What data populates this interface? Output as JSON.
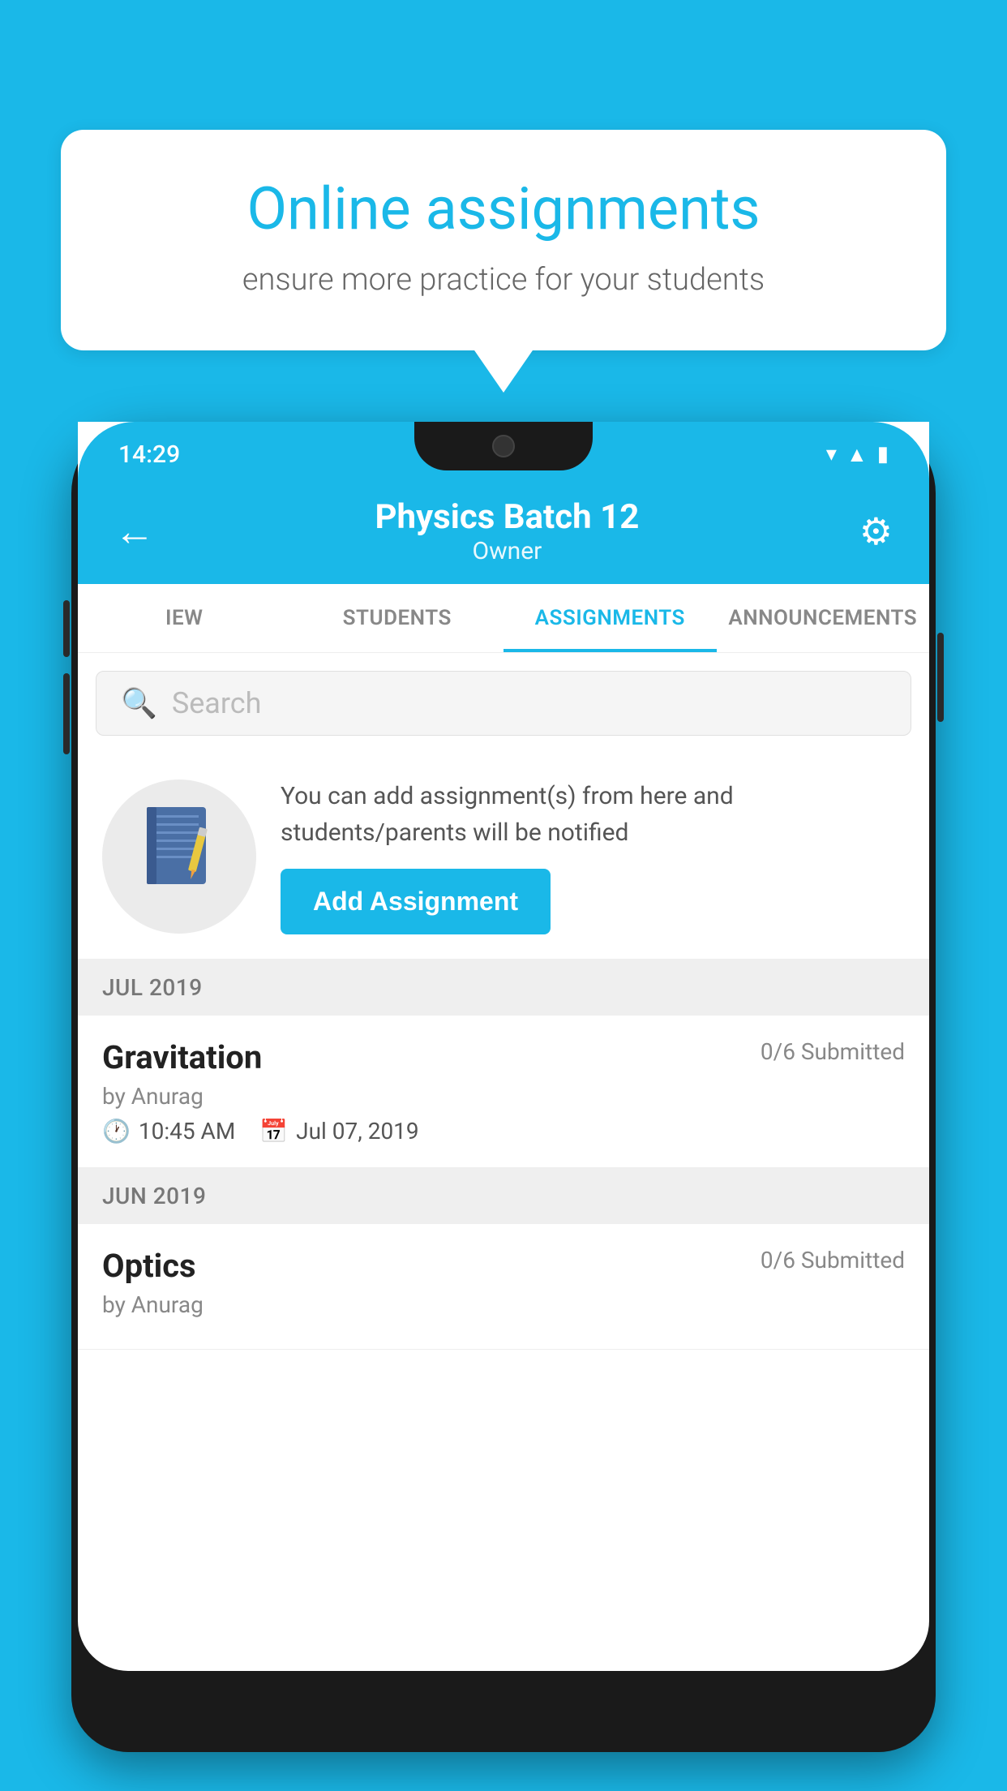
{
  "background_color": "#1ab8e8",
  "speech_bubble": {
    "title": "Online assignments",
    "subtitle": "ensure more practice for your students"
  },
  "phone": {
    "status_bar": {
      "time": "14:29",
      "icons": [
        "wifi",
        "signal",
        "battery"
      ]
    },
    "header": {
      "title": "Physics Batch 12",
      "subtitle": "Owner",
      "back_label": "←",
      "gear_label": "⚙"
    },
    "tabs": [
      {
        "label": "IEW",
        "active": false
      },
      {
        "label": "STUDENTS",
        "active": false
      },
      {
        "label": "ASSIGNMENTS",
        "active": true
      },
      {
        "label": "ANNOUNCEMENTS",
        "active": false
      }
    ],
    "search": {
      "placeholder": "Search"
    },
    "promo": {
      "text": "You can add assignment(s) from here and students/parents will be notified",
      "button_label": "Add Assignment"
    },
    "sections": [
      {
        "month": "JUL 2019",
        "assignments": [
          {
            "name": "Gravitation",
            "submitted": "0/6 Submitted",
            "by": "by Anurag",
            "time": "10:45 AM",
            "date": "Jul 07, 2019"
          }
        ]
      },
      {
        "month": "JUN 2019",
        "assignments": [
          {
            "name": "Optics",
            "submitted": "0/6 Submitted",
            "by": "by Anurag",
            "time": "",
            "date": ""
          }
        ]
      }
    ]
  }
}
